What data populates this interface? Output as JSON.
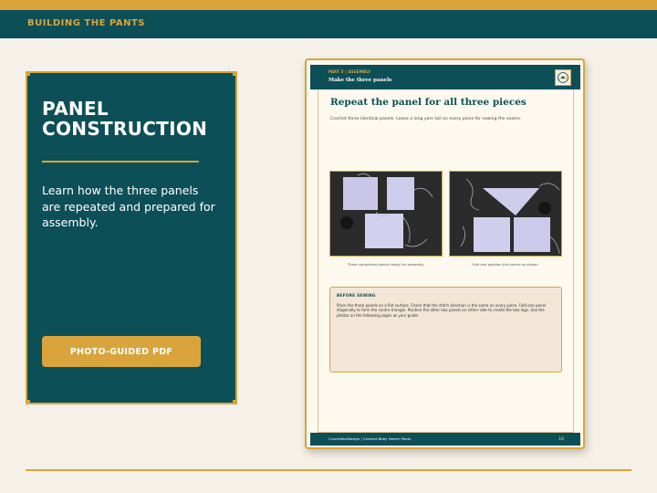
{
  "section_label": "BUILDING THE PANTS",
  "panel": {
    "title": "PANEL CONSTRUCTION",
    "description": "Learn how the three panels are repeated and prepared for assembly.",
    "button_label": "PHOTO-GUIDED PDF"
  },
  "document": {
    "part_label": "PART 3 | ASSEMBLY",
    "subtitle": "Make the three panels",
    "heading": "Repeat the panel for all three pieces",
    "intro": "Crochet three identical panels. Leave a long yarn tail on every piece for sewing the seams.",
    "photos": [
      {
        "icon": "three-panels-photo",
        "caption": "Three completed panels ready for assembly."
      },
      {
        "icon": "folded-panels-photo",
        "caption": "Fold and position the pieces as shown."
      }
    ],
    "note": {
      "title": "BEFORE SEWING",
      "text": "Place the three panels on a flat surface. Check that the stitch direction is the same on every piece. Fold one panel diagonally to form the centre triangle. Position the other two panels on either side to create the two legs. Use the photos on the following pages as your guide."
    },
    "footer": {
      "text": "CrochetArtDesign  |  Crochet Baby Harem Pants",
      "page_number": "10"
    },
    "logo_icon": "brand-logo-icon"
  },
  "colors": {
    "teal": "#0d4f57",
    "gold": "#d9a43c",
    "background": "#f5f1e8"
  }
}
